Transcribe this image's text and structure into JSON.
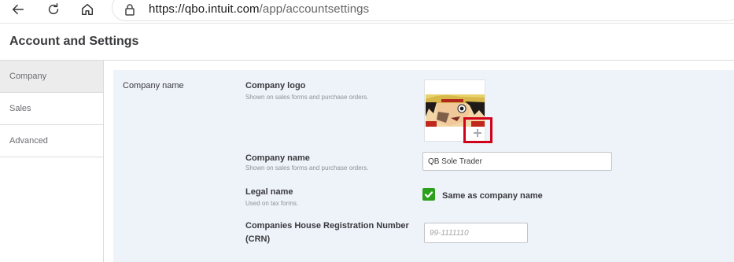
{
  "browser": {
    "url_host": "https://qbo.intuit.com",
    "url_path": "/app/accountsettings"
  },
  "page": {
    "title": "Account and Settings"
  },
  "sidebar": {
    "items": [
      {
        "label": "Company",
        "active": true
      },
      {
        "label": "Sales",
        "active": false
      },
      {
        "label": "Advanced",
        "active": false
      }
    ]
  },
  "company_section": {
    "label": "Company name",
    "logo": {
      "title": "Company logo",
      "hint": "Shown on sales forms and purchase orders."
    },
    "company_name": {
      "title": "Company name",
      "hint": "Shown on sales forms and purchase orders.",
      "value": "QB Sole Trader"
    },
    "legal_name": {
      "title": "Legal name",
      "hint": "Used on tax forms.",
      "checkbox_label": "Same as company name",
      "checked": true
    },
    "crn": {
      "title_line1": "Companies House Registration Number",
      "title_line2": "(CRN)",
      "placeholder": "99-1111110"
    }
  },
  "colors": {
    "accent_green": "#2ca01c",
    "highlight_red": "#d0021b",
    "panel_bg": "#eef3fa"
  }
}
